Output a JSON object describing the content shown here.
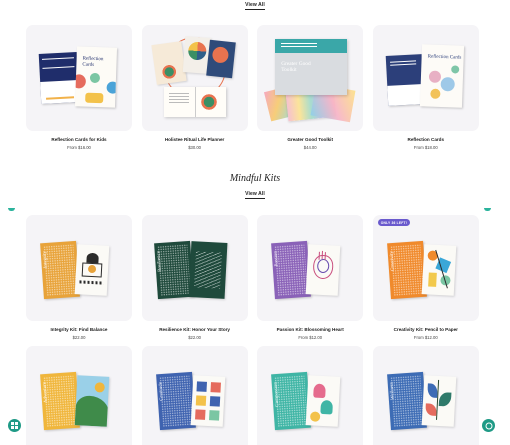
{
  "top_link": "View All",
  "section": {
    "title": "Mindful Kits",
    "link": "View All"
  },
  "row1": [
    {
      "name": "Reflection Cards for Kids",
      "price": "From $16.00"
    },
    {
      "name": "Holistee Ritual Life Planner",
      "price": "$30.00"
    },
    {
      "name": "Greater Good Toolkit",
      "price": "$44.00"
    },
    {
      "name": "Reflection Cards",
      "price": "From $18.00"
    }
  ],
  "row2": [
    {
      "name": "Integrity Kit: Find Balance",
      "price": "$22.00",
      "book_color": "#e8a33a",
      "book_word": "Integrity"
    },
    {
      "name": "Resilience Kit: Honor Your Story",
      "price": "$22.00",
      "book_color": "#1f4a3c",
      "book_word": "Resilience"
    },
    {
      "name": "Passion Kit: Blossoming Heart",
      "price": "From $12.00",
      "book_color": "#8a62b8",
      "book_word": "Passion"
    },
    {
      "name": "Creativity Kit: Pencil to Paper",
      "price": "From $12.00",
      "book_color": "#f08a2c",
      "book_word": "Creativity",
      "badge": "ONLY 36 LEFT!"
    }
  ],
  "row3": [
    {
      "book_color": "#f0b63c",
      "book_word": "Adventure"
    },
    {
      "book_color": "#3f63b0",
      "book_word": "Gratitude"
    },
    {
      "book_color": "#3fb5a5",
      "book_word": "Compassion"
    },
    {
      "book_color": "#3d6cb5",
      "book_word": "Wellness"
    }
  ],
  "colors": {
    "accent": "#2bb39c",
    "tile_bg": "#f5f4f7",
    "badge": "#6a5acd"
  },
  "floating": {
    "left_icon": "grid-icon",
    "right_icon": "chat-icon"
  }
}
